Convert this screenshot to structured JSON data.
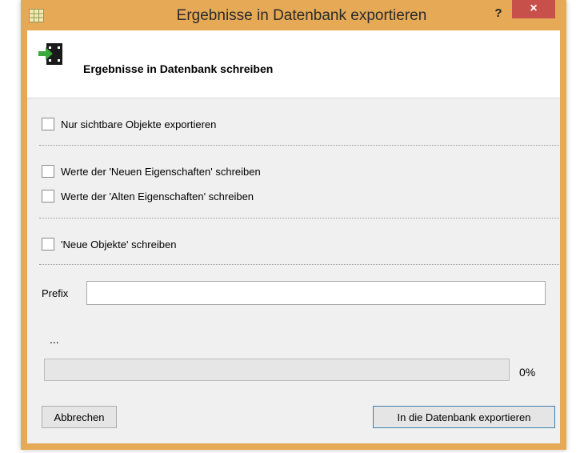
{
  "window": {
    "title": "Ergebnisse in Datenbank exportieren",
    "help_label": "?",
    "close_label": "×",
    "accent_color": "#e6a955"
  },
  "header": {
    "title": "Ergebnisse in Datenbank schreiben"
  },
  "options": {
    "visible_only": {
      "label": "Nur sichtbare Objekte exportieren",
      "checked": false
    },
    "new_properties": {
      "label": "Werte der 'Neuen Eigenschaften' schreiben",
      "checked": false
    },
    "old_properties": {
      "label": "Werte der 'Alten Eigenschaften' schreiben",
      "checked": false
    },
    "new_objects": {
      "label": "'Neue Objekte' schreiben",
      "checked": false
    }
  },
  "prefix": {
    "label": "Prefix",
    "value": ""
  },
  "status": {
    "text": "...",
    "progress_percent": 0,
    "progress_label": "0%"
  },
  "buttons": {
    "cancel": "Abbrechen",
    "export": "In die Datenbank exportieren"
  }
}
